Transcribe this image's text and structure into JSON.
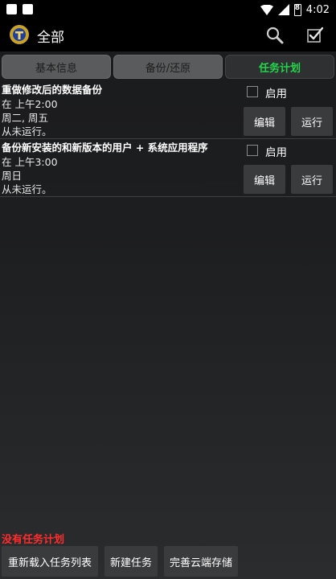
{
  "status_bar": {
    "time": "4:02",
    "battery_level": "8"
  },
  "app_bar": {
    "title": "全部"
  },
  "tabs": [
    {
      "label": "基本信息"
    },
    {
      "label": "备份/还原"
    },
    {
      "label": "任务计划"
    }
  ],
  "tasks": [
    {
      "title": "重做修改后的数据备份",
      "line1": "在 上午2:00",
      "line2": "周二, 周五",
      "line3": "从未运行。",
      "enable_label": "启用",
      "edit_label": "编辑",
      "run_label": "运行"
    },
    {
      "title": "备份新安装的和新版本的用户 + 系统应用程序",
      "line1": "在 上午3:00",
      "line2": "周日",
      "line3": "从未运行。",
      "enable_label": "启用",
      "edit_label": "编辑",
      "run_label": "运行"
    }
  ],
  "footer": {
    "empty_note": "没有任务计划",
    "reload_label": "重新载入任务列表",
    "new_task_label": "新建任务",
    "cloud_label": "完善云端存储"
  },
  "colors": {
    "active_tab": "#21d64a",
    "warning": "#ff2d2d"
  }
}
